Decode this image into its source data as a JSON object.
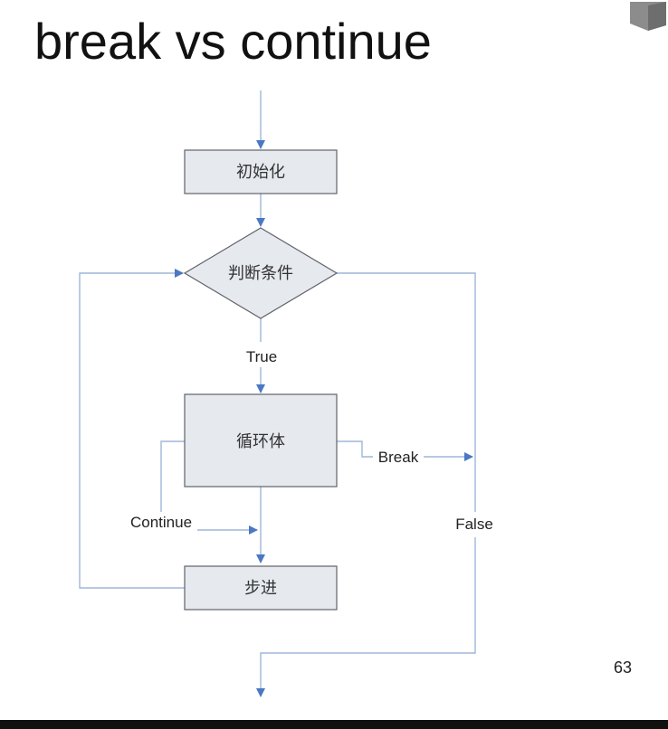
{
  "slide": {
    "title": "break vs continue",
    "page_number": "63"
  },
  "diagram": {
    "nodes": {
      "init": "初始化",
      "condition": "判断条件",
      "body": "循环体",
      "step": "步进"
    },
    "edge_labels": {
      "true": "True",
      "false": "False",
      "break": "Break",
      "continue": "Continue"
    }
  },
  "colors": {
    "box_fill": "#e6e9ee",
    "box_stroke": "#60636b",
    "connector": "#9fb6d8",
    "arrow": "#4a78c2"
  }
}
